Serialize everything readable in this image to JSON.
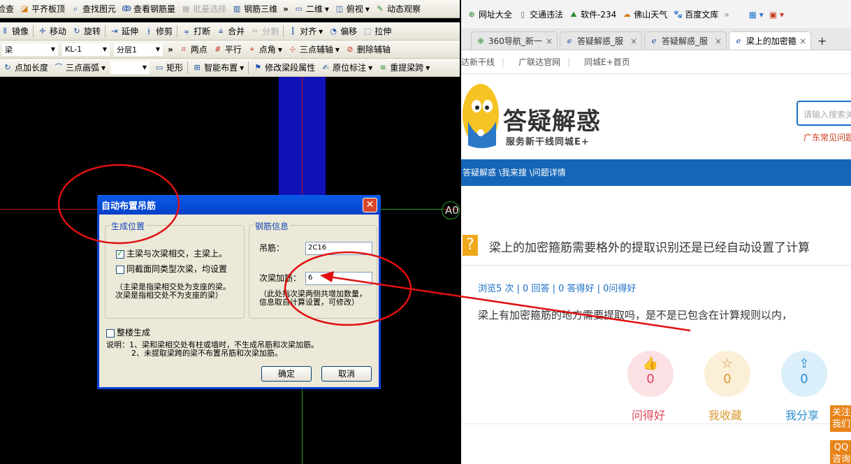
{
  "cad": {
    "toolbar1": {
      "check": "检查",
      "flat_slab_top": "平齐板顶",
      "find_element": "查找图元",
      "view_rebar_qty": "查看钢筋量",
      "batch_select": "批量选择",
      "rebar_3d": "钢筋三维",
      "more": "»",
      "view_2d": "二维",
      "top_view": "俯视",
      "dynamic_view": "动态观察"
    },
    "toolbar2": {
      "mirror": "镜像",
      "move": "移动",
      "rotate": "旋转",
      "extend": "延伸",
      "trim": "修剪",
      "break": "打断",
      "merge": "合并",
      "split": "分割",
      "align": "对齐",
      "offset": "偏移",
      "stretch": "拉伸"
    },
    "toolbar3": {
      "element_type": "梁",
      "element_name": "KL-1",
      "layer": "分层1",
      "two_point": "两点",
      "parallel": "平行",
      "point_angle": "点角",
      "three_point_axis": "三点辅轴",
      "delete_axis": "删除辅轴"
    },
    "toolbar4": {
      "point_length": "点加长度",
      "three_point_arc": "三点画弧",
      "rectangle": "矩形",
      "smart_layout": "智能布置",
      "modify_span": "修改梁段属性",
      "in_place_label": "原位标注",
      "re_extract_span": "重提梁跨"
    },
    "axis_label": "A0"
  },
  "dialog": {
    "title": "自动布置吊筋",
    "position_group": "生成位置",
    "opt_main_secondary": "主梁与次梁相交，主梁上。",
    "opt_main_secondary_checked": true,
    "opt_same_section": "同截面同类型次梁，均设置",
    "opt_same_section_checked": false,
    "note_line1": "（主梁是指梁相交处为支座的梁。",
    "note_line2": "次梁是指相交处不为支座的梁）",
    "rebar_group": "钢筋信息",
    "hanger_label": "吊筋：",
    "hanger_value": "2C16",
    "secondary_label": "次梁加筋：",
    "secondary_value": "6",
    "rebar_note1": "（此处指次梁两侧共增加数量，",
    "rebar_note2": "信息取自计算设置，可修改）",
    "whole_building": "整楼生成",
    "whole_building_checked": false,
    "desc1": "说明：1、梁和梁相交处有柱或墙时，不生成吊筋和次梁加筋。",
    "desc2": "2、未提取梁跨的梁不布置吊筋和次梁加筋。",
    "ok": "确定",
    "cancel": "取消"
  },
  "browser": {
    "bookmarks": [
      "网址大全",
      "交通违法",
      "软件-234",
      "佛山天气",
      "百度文库"
    ],
    "tabs": [
      {
        "label": "360导航_新一",
        "active": false
      },
      {
        "label": "答疑解惑_服",
        "active": false
      },
      {
        "label": "答疑解惑_服",
        "active": false
      },
      {
        "label": "梁上的加密箍",
        "active": true
      }
    ],
    "links": [
      "达新干线",
      "广联达官网",
      "同城E+首页"
    ],
    "brand": "答疑解惑",
    "slogan": "服务新干线同城E+",
    "search_placeholder": "请输入搜索关",
    "hot_text": "广东常见问题",
    "breadcrumb": "答疑解惑 \\我来搜 \\问题详情",
    "question_title": "梁上的加密箍筋需要格外的提取识别还是已经自动设置了计算",
    "stats": "浏览5 次 | 0 回答 | 0 答得好 | 0问得好",
    "question_body": "梁上有加密箍筋的地方需要提取吗，是不是已包含在计算规则以内，",
    "actions": [
      {
        "label": "问得好",
        "count": "0",
        "color": "#d9455b",
        "bg": "#fbe1e4",
        "icon": "👍"
      },
      {
        "label": "我收藏",
        "count": "0",
        "color": "#d89a32",
        "bg": "#fcefd8",
        "icon": "☆"
      },
      {
        "label": "我分享",
        "count": "0",
        "color": "#2a8bcf",
        "bg": "#dbeffa",
        "icon": "⇪"
      }
    ],
    "side_buttons": [
      "关注我们",
      "QQ咨询"
    ]
  },
  "colors": {
    "annotation": "#e01010",
    "nav_blue": "#1565b8",
    "cad_column": "#0f12b8"
  }
}
